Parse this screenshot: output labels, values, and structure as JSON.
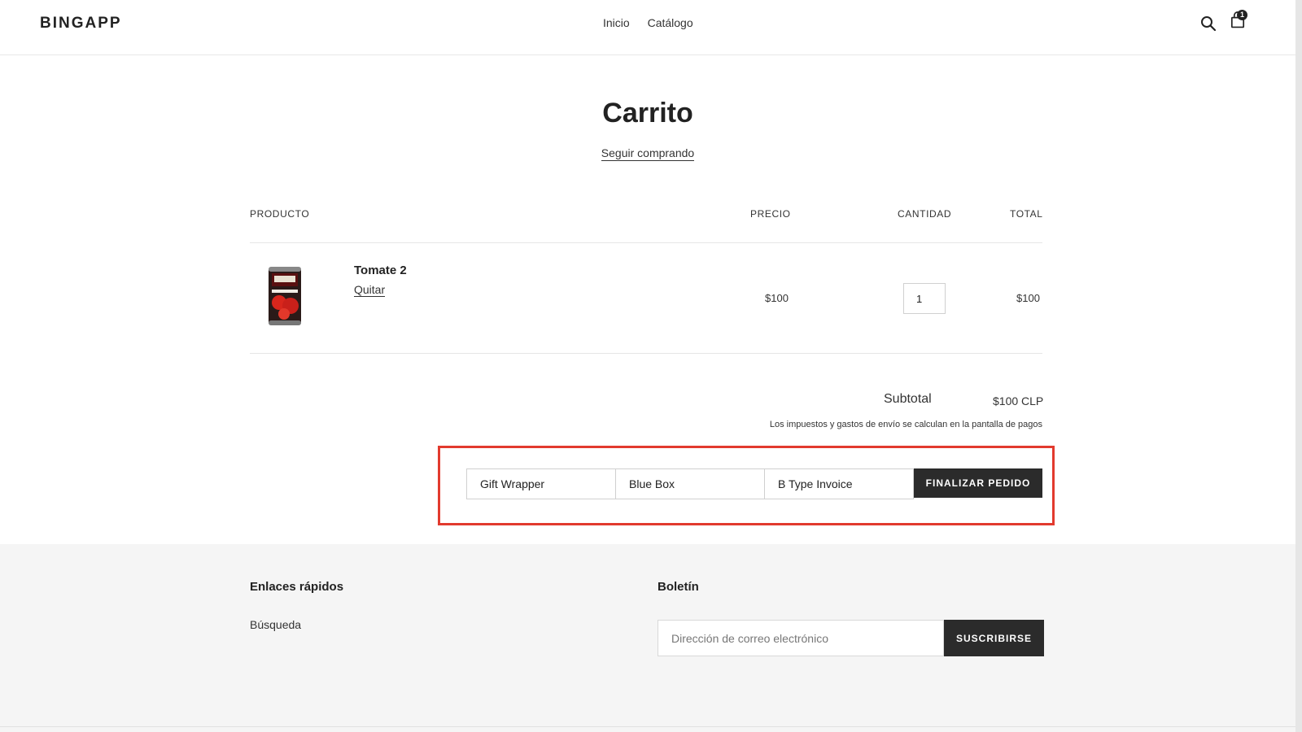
{
  "header": {
    "logo": "BINGAPP",
    "nav": [
      "Inicio",
      "Catálogo"
    ],
    "cart_count": "1"
  },
  "cart": {
    "title": "Carrito",
    "continue_link": "Seguir comprando",
    "columns": {
      "product": "PRODUCTO",
      "price": "PRECIO",
      "quantity": "CANTIDAD",
      "total": "TOTAL"
    },
    "items": [
      {
        "name": "Tomate 2",
        "remove_label": "Quitar",
        "price": "$100",
        "quantity": "1",
        "total": "$100"
      }
    ],
    "subtotal_label": "Subtotal",
    "subtotal_value": "$100 CLP",
    "tax_note": "Los impuestos y gastos de envío se calculan en la pantalla de pagos",
    "options": [
      "Gift Wrapper",
      "Blue Box",
      "B Type Invoice"
    ],
    "checkout_label": "FINALIZAR PEDIDO"
  },
  "footer": {
    "quick_links_title": "Enlaces rápidos",
    "quick_links": [
      "Búsqueda"
    ],
    "newsletter_title": "Boletín",
    "email_placeholder": "Dirección de correo electrónico",
    "subscribe_label": "SUSCRIBIRSE"
  },
  "colors": {
    "highlight": "#e23a2e",
    "button_dark": "#2b2b2b",
    "footer_bg": "#f5f5f5"
  }
}
